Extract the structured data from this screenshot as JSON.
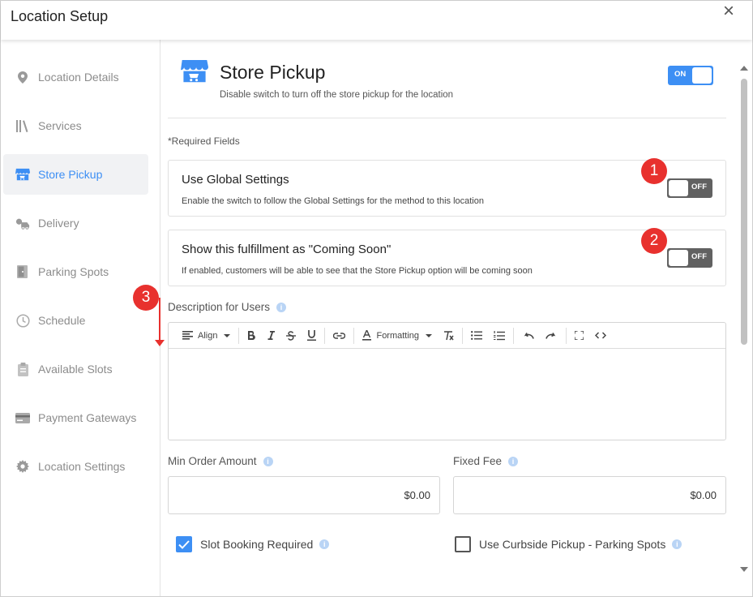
{
  "window": {
    "title": "Location Setup",
    "close_icon": "close-icon"
  },
  "sidebar": {
    "items": [
      {
        "label": "Location Details",
        "icon": "map-pin-icon"
      },
      {
        "label": "Services",
        "icon": "books-icon"
      },
      {
        "label": "Store Pickup",
        "icon": "store-icon",
        "active": true
      },
      {
        "label": "Delivery",
        "icon": "delivery-icon"
      },
      {
        "label": "Parking Spots",
        "icon": "parking-door-icon"
      },
      {
        "label": "Schedule",
        "icon": "clock-icon"
      },
      {
        "label": "Available Slots",
        "icon": "clipboard-icon"
      },
      {
        "label": "Payment Gateways",
        "icon": "card-icon"
      },
      {
        "label": "Location Settings",
        "icon": "gear-icon"
      }
    ]
  },
  "main": {
    "title": "Store Pickup",
    "subtitle": "Disable switch to turn off the store pickup for the location",
    "main_toggle": "ON",
    "required_note": "*Required Fields",
    "global_settings": {
      "title": "Use Global Settings",
      "description": "Enable the switch to follow the Global Settings for the method to this location",
      "toggle": "OFF"
    },
    "coming_soon": {
      "title": "Show this fulfillment as \"Coming Soon\"",
      "description": "If enabled, customers will be able to see that the Store Pickup option will be coming soon",
      "toggle": "OFF"
    },
    "description_label": "Description for Users",
    "editor_toolbar": {
      "align_label": "Align",
      "formatting_label": "Formatting"
    },
    "min_order": {
      "label": "Min Order Amount",
      "value": "$0.00"
    },
    "fixed_fee": {
      "label": "Fixed Fee",
      "value": "$0.00"
    },
    "slot_booking": {
      "label": "Slot Booking Required",
      "checked": true
    },
    "curbside": {
      "label": "Use Curbside Pickup - Parking Spots",
      "checked": false
    }
  },
  "annotations": [
    "1",
    "2",
    "3"
  ],
  "colors": {
    "accent": "#3d8ff4",
    "toggle_off": "#616161",
    "marker": "#e8312e"
  }
}
